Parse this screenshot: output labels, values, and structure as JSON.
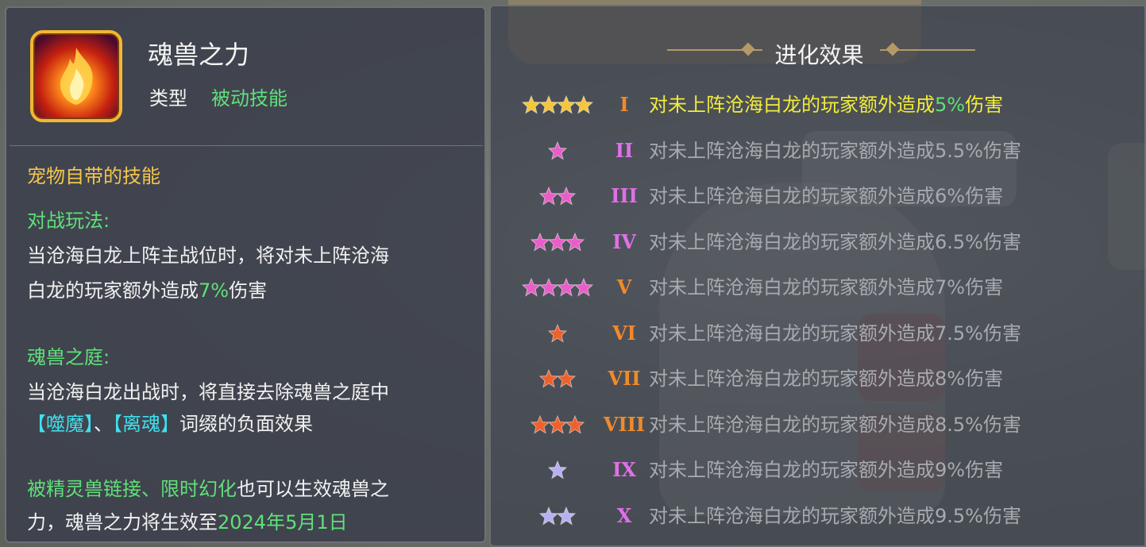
{
  "skill": {
    "name": "魂兽之力",
    "type_label": "类型",
    "type_value": "被动技能"
  },
  "description": {
    "pet_skill_heading": "宠物自带的技能",
    "battle": {
      "heading": "对战玩法:",
      "text_1": "当沧海白龙上阵主战位时，将对未上阵沧海",
      "text_2": "白龙的玩家额外造成",
      "value": "7%",
      "text_3": "伤害"
    },
    "courtyard": {
      "heading": "魂兽之庭:",
      "text_1": "当沧海白龙出战时，将直接去除魂兽之庭中",
      "tag_1": "【噬魔】",
      "sep": "、",
      "tag_2": "【离魂】",
      "text_2": "词缀的负面效果"
    },
    "link": {
      "heading": "被精灵兽链接、限时幻化",
      "text_1": "也可以生效魂兽之",
      "text_2": "力，魂兽之力将生效至",
      "date": "2024年5月1日"
    }
  },
  "evolution": {
    "title": "进化效果",
    "levels": [
      {
        "roman": "I",
        "stars": 4,
        "star_color": "#f5c53a",
        "roman_color": "#f08a2a",
        "text": "对未上阵沧海白龙的玩家额外造成",
        "value": "5%",
        "suffix": "伤害",
        "active": true
      },
      {
        "roman": "II",
        "stars": 1,
        "star_color": "#e85ec8",
        "roman_color": "#e070e8",
        "text": "对未上阵沧海白龙的玩家额外造成5.5%伤害",
        "active": false
      },
      {
        "roman": "III",
        "stars": 2,
        "star_color": "#e85ec8",
        "roman_color": "#e070e8",
        "text": "对未上阵沧海白龙的玩家额外造成6%伤害",
        "active": false
      },
      {
        "roman": "IV",
        "stars": 3,
        "star_color": "#e85ec8",
        "roman_color": "#e070e8",
        "text": "对未上阵沧海白龙的玩家额外造成6.5%伤害",
        "active": false
      },
      {
        "roman": "V",
        "stars": 4,
        "star_color": "#e85ec8",
        "roman_color": "#f08a2a",
        "text": "对未上阵沧海白龙的玩家额外造成7%伤害",
        "active": false
      },
      {
        "roman": "VI",
        "stars": 1,
        "star_color": "#f0602a",
        "roman_color": "#f08a2a",
        "text": "对未上阵沧海白龙的玩家额外造成7.5%伤害",
        "active": false
      },
      {
        "roman": "VII",
        "stars": 2,
        "star_color": "#f0602a",
        "roman_color": "#f08a2a",
        "text": "对未上阵沧海白龙的玩家额外造成8%伤害",
        "active": false
      },
      {
        "roman": "VIII",
        "stars": 3,
        "star_color": "#f0602a",
        "roman_color": "#f08a2a",
        "text": "对未上阵沧海白龙的玩家额外造成8.5%伤害",
        "active": false
      },
      {
        "roman": "IX",
        "stars": 1,
        "star_color": "#b8b0f0",
        "roman_color": "#e070e8",
        "text": "对未上阵沧海白龙的玩家额外造成9%伤害",
        "active": false
      },
      {
        "roman": "X",
        "stars": 2,
        "star_color": "#b8b0f0",
        "roman_color": "#e070e8",
        "text": "对未上阵沧海白龙的玩家额外造成9.5%伤害",
        "active": false
      }
    ]
  }
}
